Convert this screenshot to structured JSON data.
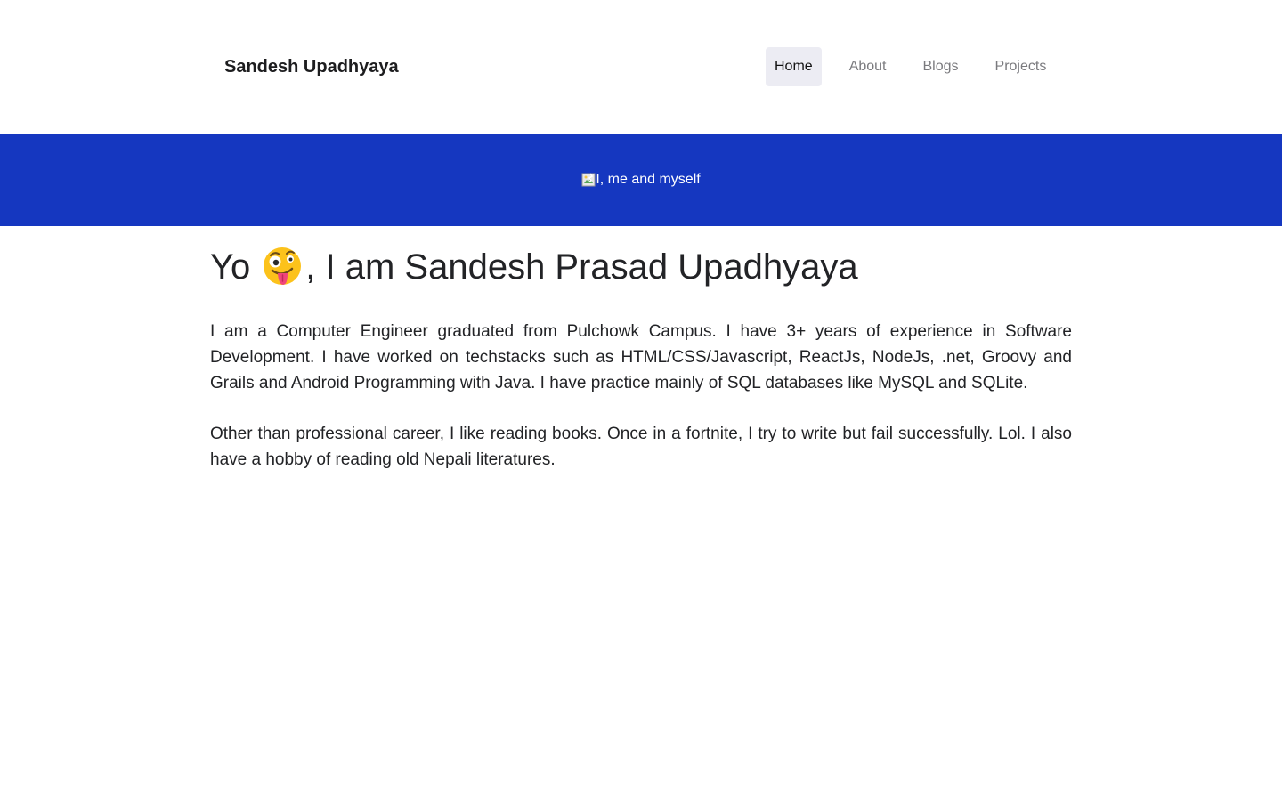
{
  "header": {
    "brand": "Sandesh Upadhyaya",
    "nav": [
      {
        "label": "Home",
        "active": true
      },
      {
        "label": "About",
        "active": false
      },
      {
        "label": "Blogs",
        "active": false
      },
      {
        "label": "Projects",
        "active": false
      }
    ]
  },
  "banner": {
    "image_alt": "I, me and myself",
    "background": "#1537c0",
    "icon": "broken-image-icon"
  },
  "main": {
    "title_prefix": "Yo",
    "title_emoji": "zany-face-emoji",
    "title_suffix": ", I am Sandesh Prasad Upadhyaya",
    "paragraphs": [
      "I am a Computer Engineer graduated from Pulchowk Campus. I have 3+ years of experience in Software Development. I have worked on techstacks such as HTML/CSS/Javascript, ReactJs, NodeJs, .net, Groovy and Grails and Android Programming with Java. I have practice mainly of SQL databases like MySQL and SQLite.",
      "Other than professional career, I like reading books. Once in a fortnite, I try to write but fail successfully. Lol. I also have a hobby of reading old Nepali literatures."
    ]
  },
  "colors": {
    "accent": "#1537c0",
    "active_nav_bg": "#ececf3",
    "nav_text": "#7a7a7e"
  }
}
